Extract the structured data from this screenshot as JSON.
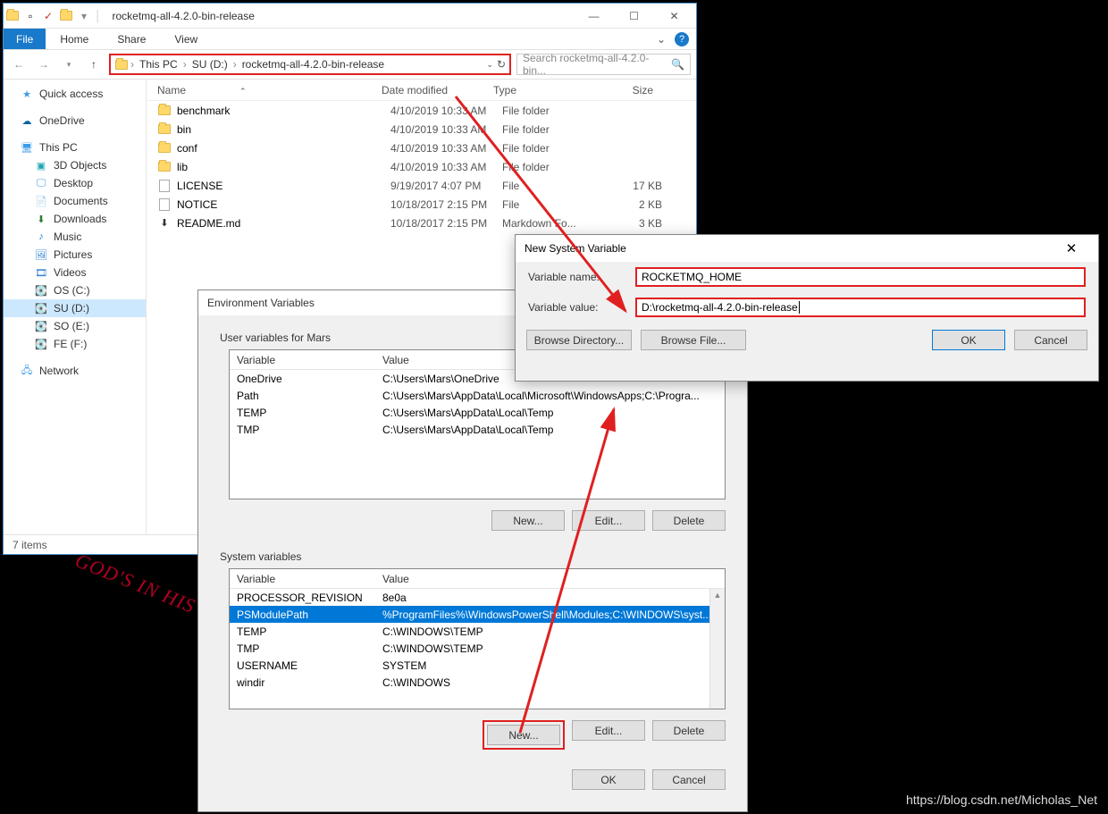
{
  "explorer": {
    "title": "rocketmq-all-4.2.0-bin-release",
    "ribbon": {
      "file": "File",
      "home": "Home",
      "share": "Share",
      "view": "View"
    },
    "breadcrumb": [
      "This PC",
      "SU (D:)",
      "rocketmq-all-4.2.0-bin-release"
    ],
    "search_placeholder": "Search rocketmq-all-4.2.0-bin...",
    "columns": {
      "name": "Name",
      "date": "Date modified",
      "type": "Type",
      "size": "Size"
    },
    "items": [
      {
        "icon": "folder",
        "name": "benchmark",
        "date": "4/10/2019 10:33 AM",
        "type": "File folder",
        "size": ""
      },
      {
        "icon": "folder",
        "name": "bin",
        "date": "4/10/2019 10:33 AM",
        "type": "File folder",
        "size": ""
      },
      {
        "icon": "folder",
        "name": "conf",
        "date": "4/10/2019 10:33 AM",
        "type": "File folder",
        "size": ""
      },
      {
        "icon": "folder",
        "name": "lib",
        "date": "4/10/2019 10:33 AM",
        "type": "File folder",
        "size": ""
      },
      {
        "icon": "file",
        "name": "LICENSE",
        "date": "9/19/2017 4:07 PM",
        "type": "File",
        "size": "17 KB"
      },
      {
        "icon": "file",
        "name": "NOTICE",
        "date": "10/18/2017 2:15 PM",
        "type": "File",
        "size": "2 KB"
      },
      {
        "icon": "md",
        "name": "README.md",
        "date": "10/18/2017 2:15 PM",
        "type": "Markdown Fo...",
        "size": "3 KB"
      }
    ],
    "sidebar": {
      "quick_access": "Quick access",
      "onedrive": "OneDrive",
      "this_pc": "This PC",
      "objects": "3D Objects",
      "desktop": "Desktop",
      "documents": "Documents",
      "downloads": "Downloads",
      "music": "Music",
      "pictures": "Pictures",
      "videos": "Videos",
      "osc": "OS (C:)",
      "sud": "SU (D:)",
      "soe": "SO (E:)",
      "fef": "FE (F:)",
      "network": "Network"
    },
    "status": "7 items"
  },
  "env": {
    "title": "Environment Variables",
    "user_label": "User variables for Mars",
    "sys_label": "System variables",
    "cols": {
      "var": "Variable",
      "val": "Value"
    },
    "user_vars": [
      {
        "name": "OneDrive",
        "value": "C:\\Users\\Mars\\OneDrive"
      },
      {
        "name": "Path",
        "value": "C:\\Users\\Mars\\AppData\\Local\\Microsoft\\WindowsApps;C:\\Progra..."
      },
      {
        "name": "TEMP",
        "value": "C:\\Users\\Mars\\AppData\\Local\\Temp"
      },
      {
        "name": "TMP",
        "value": "C:\\Users\\Mars\\AppData\\Local\\Temp"
      }
    ],
    "sys_vars": [
      {
        "name": "PROCESSOR_REVISION",
        "value": "8e0a"
      },
      {
        "name": "PSModulePath",
        "value": "%ProgramFiles%\\WindowsPowerShell\\Modules;C:\\WINDOWS\\syst..."
      },
      {
        "name": "TEMP",
        "value": "C:\\WINDOWS\\TEMP"
      },
      {
        "name": "TMP",
        "value": "C:\\WINDOWS\\TEMP"
      },
      {
        "name": "USERNAME",
        "value": "SYSTEM"
      },
      {
        "name": "windir",
        "value": "C:\\WINDOWS"
      }
    ],
    "btn_new": "New...",
    "btn_edit": "Edit...",
    "btn_delete": "Delete",
    "btn_ok": "OK",
    "btn_cancel": "Cancel"
  },
  "newvar": {
    "title": "New System Variable",
    "name_label": "Variable name:",
    "value_label": "Variable value:",
    "name_value": "ROCKETMQ_HOME",
    "value_value": "D:\\rocketmq-all-4.2.0-bin-release",
    "browse_dir": "Browse Directory...",
    "browse_file": "Browse File...",
    "ok": "OK",
    "cancel": "Cancel"
  },
  "watermark": "GOD'S IN HIS",
  "credit": "https://blog.csdn.net/Micholas_Net"
}
